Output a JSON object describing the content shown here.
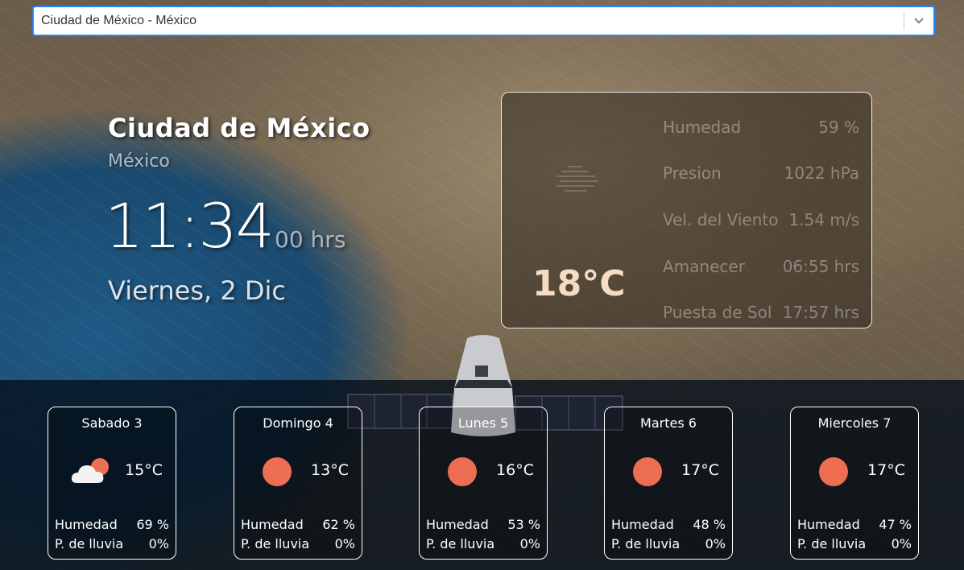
{
  "location_select": {
    "value": "Ciudad de México - México",
    "arrow_icon": "chevron-down-icon"
  },
  "current": {
    "city": "Ciudad de México",
    "country": "México",
    "time_main": "11:34",
    "time_sub": "00 hrs",
    "date": "Viernes, 2 Dic",
    "temp": "18°C",
    "icon": "fog-icon",
    "stats": [
      {
        "label": "Humedad",
        "value": "59 %"
      },
      {
        "label": "Presion",
        "value": "1022 hPa"
      },
      {
        "label": "Vel. del Viento",
        "value": "1.54 m/s"
      },
      {
        "label": "Amanecer",
        "value": "06:55 hrs"
      },
      {
        "label": "Puesta de Sol",
        "value": "17:57 hrs"
      }
    ]
  },
  "forecast": [
    {
      "day": "Sabado 3",
      "temp": "15°C",
      "icon": "partly-cloudy-icon",
      "humidity_label": "Humedad",
      "humidity": "69 %",
      "rain_label": "P. de lluvia",
      "rain": "0%"
    },
    {
      "day": "Domingo 4",
      "temp": "13°C",
      "icon": "sun-icon",
      "humidity_label": "Humedad",
      "humidity": "62 %",
      "rain_label": "P. de lluvia",
      "rain": "0%"
    },
    {
      "day": "Lunes 5",
      "temp": "16°C",
      "icon": "sun-icon",
      "humidity_label": "Humedad",
      "humidity": "53 %",
      "rain_label": "P. de lluvia",
      "rain": "0%"
    },
    {
      "day": "Martes 6",
      "temp": "17°C",
      "icon": "sun-icon",
      "humidity_label": "Humedad",
      "humidity": "48 %",
      "rain_label": "P. de lluvia",
      "rain": "0%"
    },
    {
      "day": "Miercoles 7",
      "temp": "17°C",
      "icon": "sun-icon",
      "humidity_label": "Humedad",
      "humidity": "47 %",
      "rain_label": "P. de lluvia",
      "rain": "0%"
    }
  ],
  "colors": {
    "sun": "#ee6e54",
    "select_border": "#2684ff",
    "temp_accent": "#f6dcc2"
  }
}
